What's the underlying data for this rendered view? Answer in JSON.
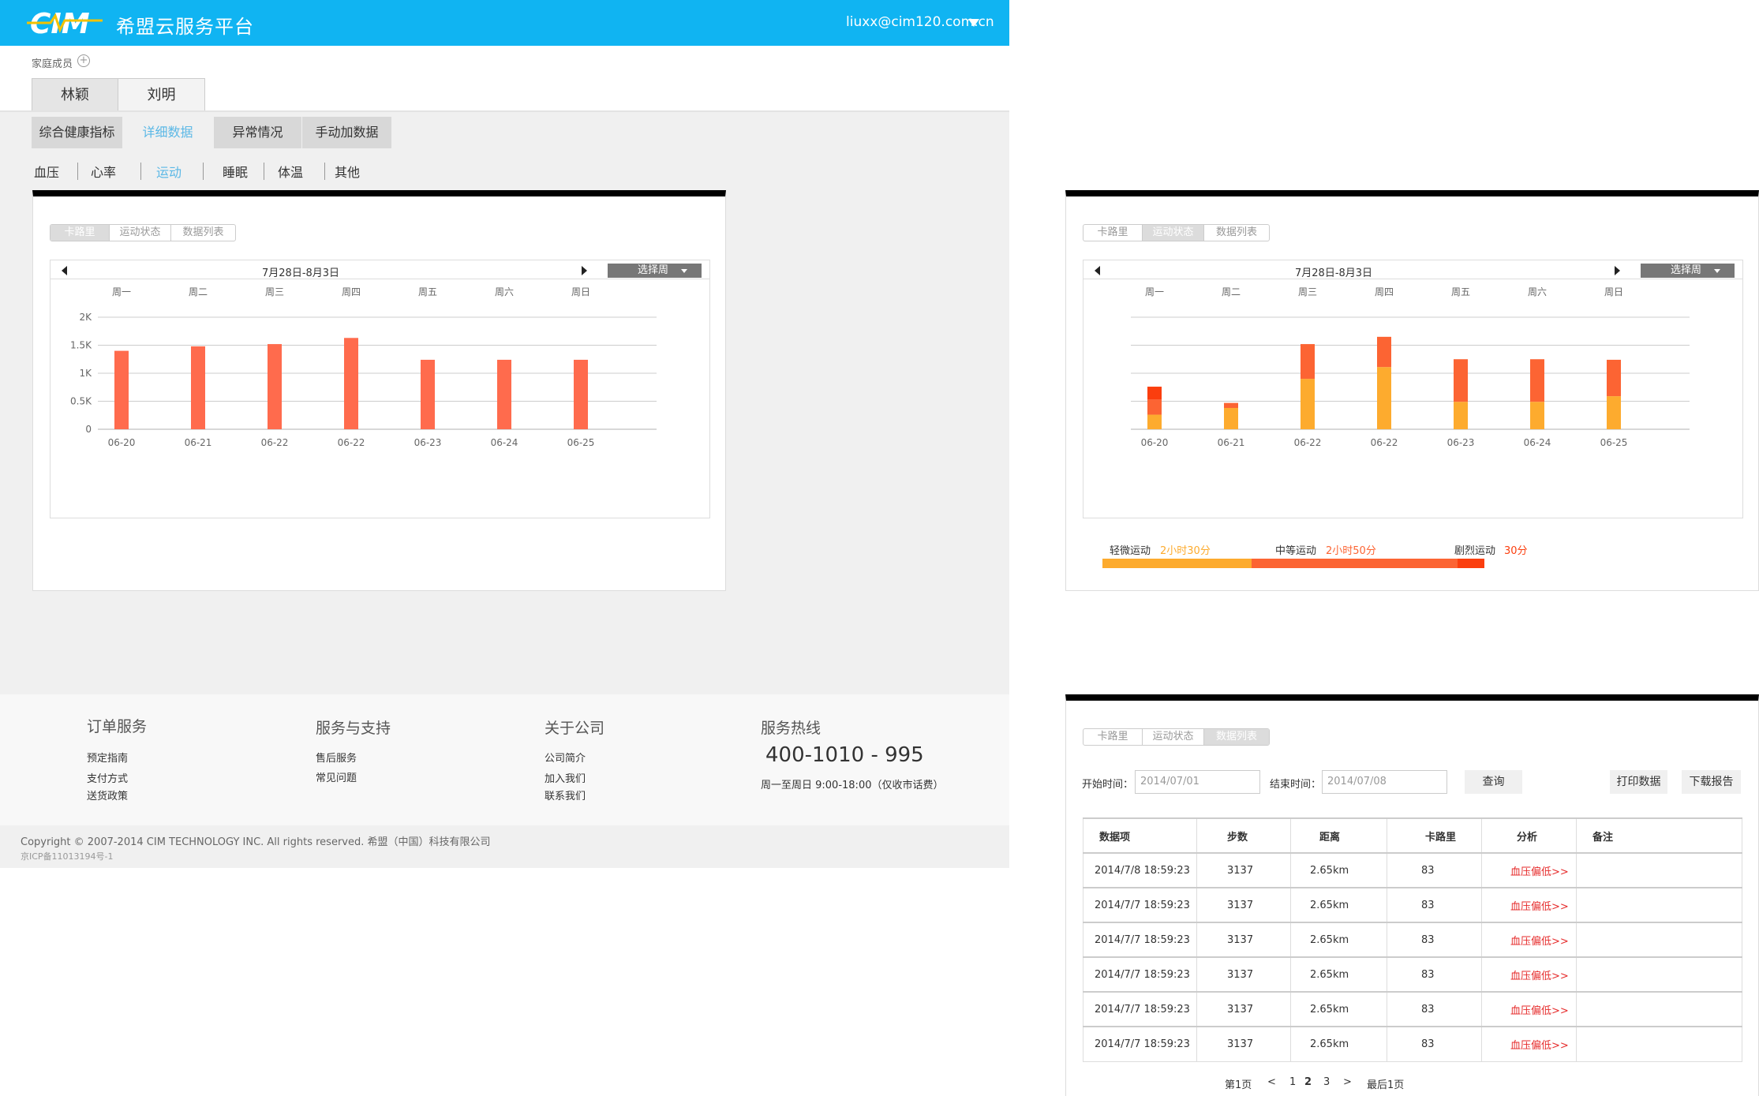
{
  "header": {
    "logo_text": "CIM",
    "title": "希盟云服务平台",
    "user_email": "liuxx@cim120.com.cn"
  },
  "family": {
    "label": "家庭成员",
    "add_symbol": "+",
    "members": [
      "林颖",
      "刘明"
    ]
  },
  "main_tabs": [
    "综合健康指标",
    "详细数据",
    "异常情况",
    "手动加数据"
  ],
  "sub_tabs": [
    "血压",
    "心率",
    "运动",
    "睡眠",
    "体温",
    "其他"
  ],
  "view_tabs": [
    "卡路里",
    "运动状态",
    "数据列表"
  ],
  "week_range": "7月28日-8月3日",
  "pick_week": "选择周",
  "weekdays": [
    "周一",
    "周二",
    "周三",
    "周四",
    "周五",
    "周六",
    "周日"
  ],
  "colors": {
    "header": "#10b4f2",
    "bar": "#ff6b4d",
    "light": "#fdab2e",
    "moderate": "#fc6433",
    "intense": "#fb3e0e",
    "link_red": "#e62b2b",
    "active_tab": "#5bb8e6"
  },
  "chart_data": [
    {
      "type": "bar",
      "categories": [
        "06-20",
        "06-21",
        "06-22",
        "06-22",
        "06-23",
        "06-24",
        "06-25"
      ],
      "values": [
        1400,
        1480,
        1520,
        1630,
        1240,
        1240,
        1240
      ],
      "ylim": [
        0,
        2000
      ],
      "yticks": [
        "0",
        "0.5K",
        "1K",
        "1.5K",
        "2K"
      ],
      "grid": true
    },
    {
      "type": "bar",
      "stacked": true,
      "categories": [
        "06-20",
        "06-21",
        "06-22",
        "06-22",
        "06-23",
        "06-24",
        "06-25"
      ],
      "series": [
        {
          "name": "轻微运动",
          "values": [
            260,
            380,
            900,
            1110,
            490,
            490,
            590
          ]
        },
        {
          "name": "中等运动",
          "values": [
            270,
            90,
            620,
            540,
            760,
            760,
            650
          ]
        },
        {
          "name": "剧烈运动",
          "values": [
            230,
            0,
            0,
            0,
            0,
            0,
            0
          ]
        }
      ],
      "ylim": [
        0,
        2000
      ],
      "grid": true
    }
  ],
  "legend": [
    {
      "label": "轻微运动",
      "value": "2小时30分",
      "fraction": 0.39
    },
    {
      "label": "中等运动",
      "value": "2小时50分",
      "fraction": 0.54
    },
    {
      "label": "剧烈运动",
      "value": "30分",
      "fraction": 0.07
    }
  ],
  "filter": {
    "start_label": "开始时间：",
    "start_value": "2014/07/01",
    "end_label": "结束时间：",
    "end_value": "2014/07/08",
    "query": "查询",
    "print": "打印数据",
    "download": "下载报告"
  },
  "table": {
    "headers": [
      "数据项",
      "步数",
      "距离",
      "卡路里",
      "分析",
      "备注"
    ],
    "rows": [
      [
        "2014/7/8 18:59:23",
        "3137",
        "2.65km",
        "83",
        "血压偏低>>",
        ""
      ],
      [
        "2014/7/7 18:59:23",
        "3137",
        "2.65km",
        "83",
        "血压偏低>>",
        ""
      ],
      [
        "2014/7/7 18:59:23",
        "3137",
        "2.65km",
        "83",
        "血压偏低>>",
        ""
      ],
      [
        "2014/7/7 18:59:23",
        "3137",
        "2.65km",
        "83",
        "血压偏低>>",
        ""
      ],
      [
        "2014/7/7 18:59:23",
        "3137",
        "2.65km",
        "83",
        "血压偏低>>",
        ""
      ],
      [
        "2014/7/7 18:59:23",
        "3137",
        "2.65km",
        "83",
        "血压偏低>>",
        ""
      ]
    ]
  },
  "pager": {
    "first": "第1页",
    "prev": "<",
    "pages": [
      "1",
      "2",
      "3"
    ],
    "next": ">",
    "last": "最后1页"
  },
  "footer": {
    "columns": [
      {
        "title": "订单服务",
        "links": [
          "预定指南",
          "支付方式",
          "送货政策"
        ]
      },
      {
        "title": "服务与支持",
        "links": [
          "售后服务",
          "常见问题"
        ]
      },
      {
        "title": "关于公司",
        "links": [
          "公司简介",
          "加入我们",
          "联系我们"
        ]
      }
    ],
    "hotline_title": "服务热线",
    "hotline": "400-1010 - 995",
    "hours": "周一至周日 9:00-18:00（仅收市话费）",
    "copyright": "Copyright © 2007-2014 CIM TECHNOLOGY INC. All rights reserved. 希盟（中国）科技有限公司",
    "icp": "京ICP备11013194号-1"
  }
}
